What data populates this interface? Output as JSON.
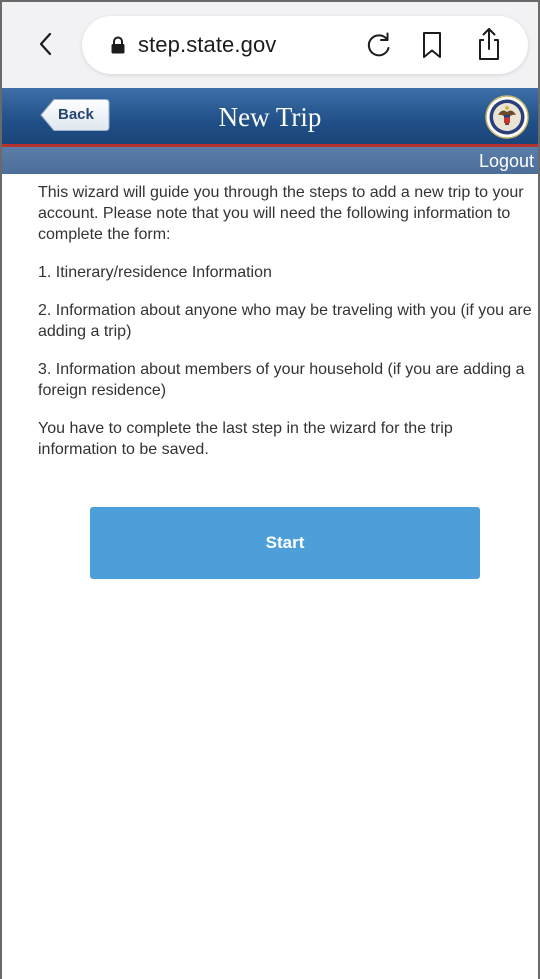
{
  "browser": {
    "url": "step.state.gov"
  },
  "header": {
    "back_label": "Back",
    "title": "New Trip",
    "logout_label": "Logout"
  },
  "content": {
    "intro": "This wizard will guide you through the steps to add a new trip to your account. Please note that you will need the following information to complete the form:",
    "items": [
      "1. Itinerary/residence Information",
      "2. Information about anyone who may be traveling with you (if you are adding a trip)",
      "3. Information about members of your household (if you are adding a foreign residence)"
    ],
    "note": "You have to complete the last step in the wizard for the trip information to be saved.",
    "start_label": "Start"
  },
  "icons": {
    "browser_back": "chevron-left-icon",
    "lock": "lock-icon",
    "reload": "reload-icon",
    "bookmark": "bookmark-icon",
    "share": "share-icon",
    "seal": "state-department-seal-icon"
  },
  "colors": {
    "header_blue": "#1f4f86",
    "accent_red": "#b8322f",
    "button_blue": "#4d9fda"
  }
}
